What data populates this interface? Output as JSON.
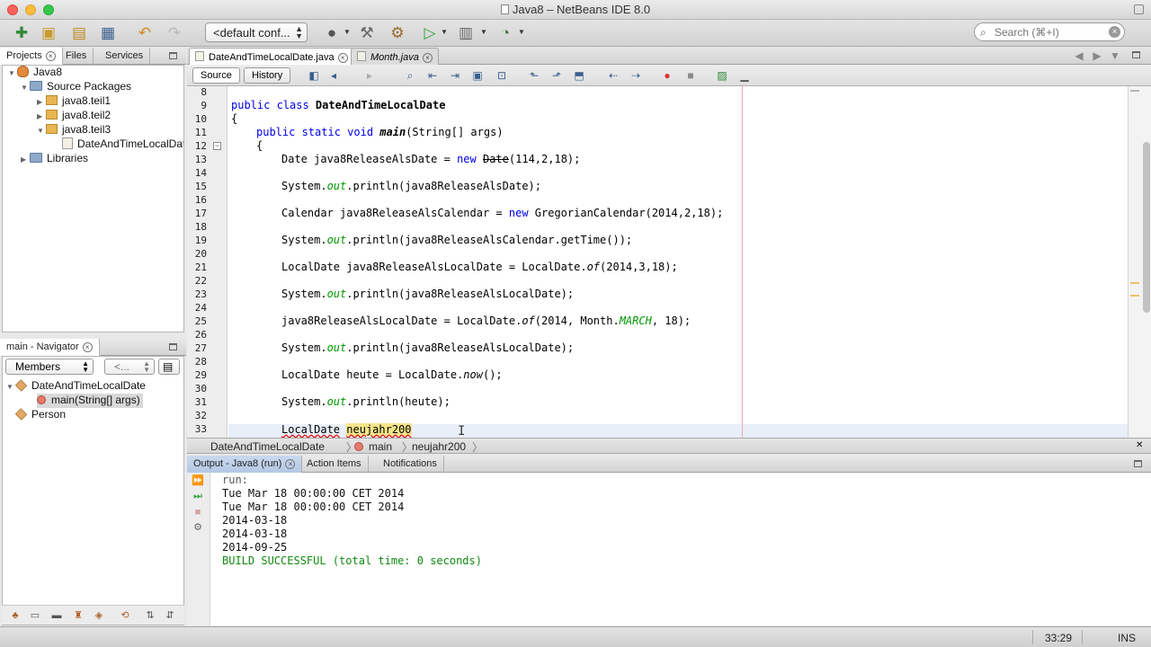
{
  "window": {
    "title": "Java8 – NetBeans IDE 8.0"
  },
  "toolbar": {
    "config_value": "<default conf...",
    "search_placeholder": "Search (⌘+I)"
  },
  "projects_panel": {
    "tabs": [
      "Projects",
      "Files",
      "Services"
    ],
    "tree": [
      {
        "label": "Java8",
        "icon": "coffee-cup-icon",
        "level": 0,
        "expanded": true
      },
      {
        "label": "Source Packages",
        "icon": "folder-icon",
        "level": 1,
        "expanded": true
      },
      {
        "label": "java8.teil1",
        "icon": "package-icon",
        "level": 2,
        "expanded": false
      },
      {
        "label": "java8.teil2",
        "icon": "package-icon",
        "level": 2,
        "expanded": false
      },
      {
        "label": "java8.teil3",
        "icon": "package-icon",
        "level": 2,
        "expanded": true
      },
      {
        "label": "DateAndTimeLocalDate",
        "icon": "java-file-icon",
        "level": 3,
        "expanded": false
      },
      {
        "label": "Libraries",
        "icon": "folder-icon",
        "level": 1,
        "expanded": false
      }
    ]
  },
  "navigator": {
    "title": "main - Navigator",
    "filter_value": "Members",
    "second_filter": "<...",
    "tree": [
      {
        "label": "DateAndTimeLocalDate",
        "icon": "class-icon",
        "level": 0
      },
      {
        "label": "main(String[] args)",
        "icon": "method-icon",
        "level": 1,
        "selected": true
      },
      {
        "label": "Person",
        "icon": "class-icon",
        "level": 0
      }
    ]
  },
  "editor": {
    "tabs": [
      {
        "label": "DateAndTimeLocalDate.java",
        "active": true
      },
      {
        "label": "Month.java",
        "active": false
      }
    ],
    "source_label": "Source",
    "history_label": "History",
    "line_numbers": [
      "8",
      "9",
      "10",
      "11",
      "12",
      "13",
      "14",
      "15",
      "16",
      "17",
      "18",
      "19",
      "20",
      "21",
      "22",
      "23",
      "24",
      "25",
      "26",
      "27",
      "28",
      "29",
      "30",
      "31",
      "32",
      "33"
    ],
    "code": {
      "l9_kw": "public class ",
      "l9_cls": "DateAndTimeLocalDate",
      "l10": "{",
      "l11_kw": "public static void ",
      "l11_m": "main",
      "l11_rest": "(String[] args)",
      "l12": "{",
      "l13_a": "Date java8ReleaseAlsDate = ",
      "l13_kw": "new ",
      "l13_dep": "Date",
      "l13_b": "(114,2,18);",
      "l15_a": "System.",
      "l15_f": "out",
      "l15_b": ".println(java8ReleaseAlsDate);",
      "l17_a": "Calendar java8ReleaseAlsCalendar = ",
      "l17_kw": "new ",
      "l17_b": "GregorianCalendar(2014,2,18);",
      "l19_a": "System.",
      "l19_f": "out",
      "l19_b": ".println(java8ReleaseAlsCalendar.getTime());",
      "l21_a": "LocalDate java8ReleaseAlsLocalDate = LocalDate.",
      "l21_s": "of",
      "l21_b": "(2014,3,18);",
      "l23_a": "System.",
      "l23_f": "out",
      "l23_b": ".println(java8ReleaseAlsLocalDate);",
      "l25_a": "java8ReleaseAlsLocalDate = LocalDate.",
      "l25_s": "of",
      "l25_b": "(2014, Month.",
      "l25_f": "MARCH",
      "l25_c": ", 18);",
      "l27_a": "System.",
      "l27_f": "out",
      "l27_b": ".println(java8ReleaseAlsLocalDate);",
      "l29_a": "LocalDate heute = LocalDate.",
      "l29_s": "now",
      "l29_b": "();",
      "l31_a": "System.",
      "l31_f": "out",
      "l31_b": ".println(heute);",
      "l33_a": "LocalDate",
      "l33_b": "neujahr200"
    }
  },
  "breadcrumb": [
    "DateAndTimeLocalDate",
    "main",
    "neujahr200"
  ],
  "output": {
    "tabs": [
      "Output - Java8 (run)",
      "Action Items",
      "Notifications"
    ],
    "lines": [
      "run:",
      "Tue Mar 18 00:00:00 CET 2014",
      "Tue Mar 18 00:00:00 CET 2014",
      "2014-03-18",
      "2014-03-18",
      "2014-09-25",
      "BUILD SUCCESSFUL (total time: 0 seconds)"
    ]
  },
  "statusbar": {
    "position": "33:29",
    "mode": "INS"
  },
  "colors": {
    "keyword": "#0000e6",
    "field": "#009900",
    "success": "#108a10"
  }
}
